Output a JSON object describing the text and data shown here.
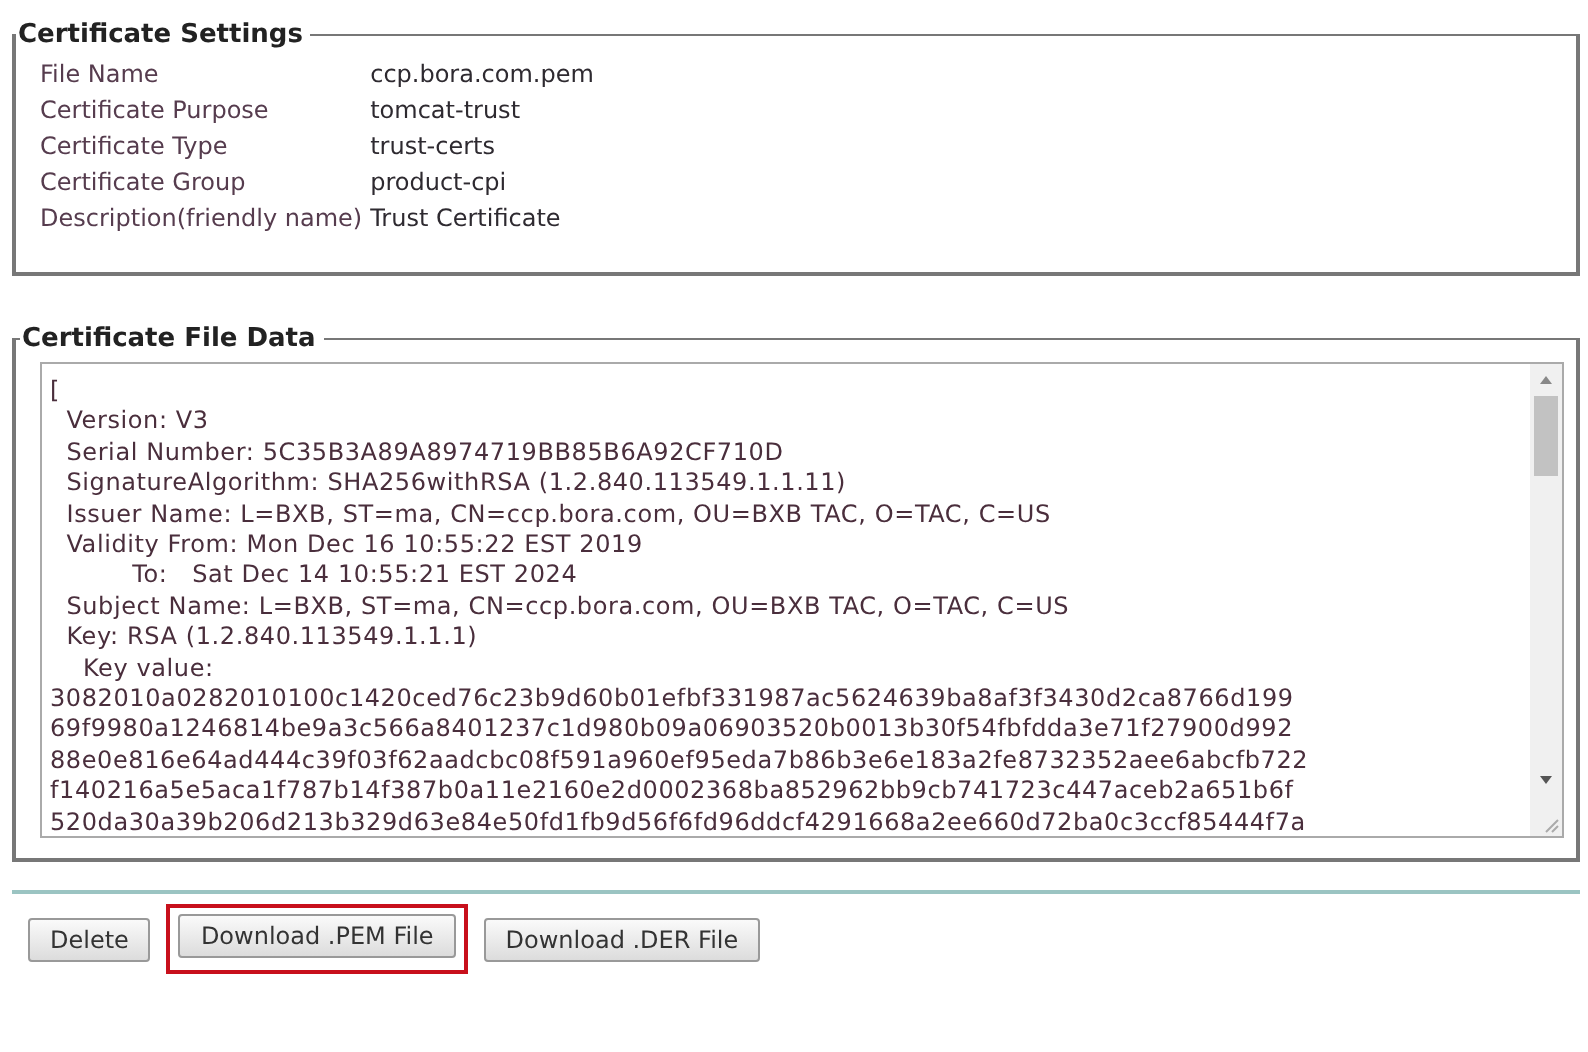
{
  "settings": {
    "legend": "Certificate Settings",
    "rows": [
      {
        "label": "File Name",
        "value": "ccp.bora.com.pem"
      },
      {
        "label": "Certificate Purpose",
        "value": "tomcat-trust"
      },
      {
        "label": "Certificate Type",
        "value": "trust-certs"
      },
      {
        "label": "Certificate Group",
        "value": "product-cpi"
      },
      {
        "label": "Description(friendly name)",
        "value": "Trust Certificate"
      }
    ]
  },
  "file_data": {
    "legend": "Certificate File Data",
    "lines": [
      "[",
      "  Version: V3",
      "  Serial Number: 5C35B3A89A8974719BB85B6A92CF710D",
      "  SignatureAlgorithm: SHA256withRSA (1.2.840.113549.1.1.11)",
      "  Issuer Name: L=BXB, ST=ma, CN=ccp.bora.com, OU=BXB TAC, O=TAC, C=US",
      "  Validity From: Mon Dec 16 10:55:22 EST 2019",
      "          To:   Sat Dec 14 10:55:21 EST 2024",
      "  Subject Name: L=BXB, ST=ma, CN=ccp.bora.com, OU=BXB TAC, O=TAC, C=US",
      "  Key: RSA (1.2.840.113549.1.1.1)",
      "    Key value:",
      "3082010a0282010100c1420ced76c23b9d60b01efbf331987ac5624639ba8af3f3430d2ca8766d199",
      "69f9980a1246814be9a3c566a8401237c1d980b09a06903520b0013b30f54fbfdda3e71f27900d992",
      "88e0e816e64ad444c39f03f62aadcbc08f591a960ef95eda7b86b3e6e183a2fe8732352aee6abcfb722",
      "f140216a5e5aca1f787b14f387b0a11e2160e2d0002368ba852962bb9cb741723c447aceb2a651b6f",
      "520da30a39b206d213b329d63e84e50fd1fb9d56f6fd96ddcf4291668a2ee660d72ba0c3ccf85444f7a"
    ]
  },
  "buttons": [
    {
      "label": "Delete",
      "highlighted": false
    },
    {
      "label": "Download .PEM File",
      "highlighted": true
    },
    {
      "label": "Download .DER File",
      "highlighted": false
    }
  ]
}
